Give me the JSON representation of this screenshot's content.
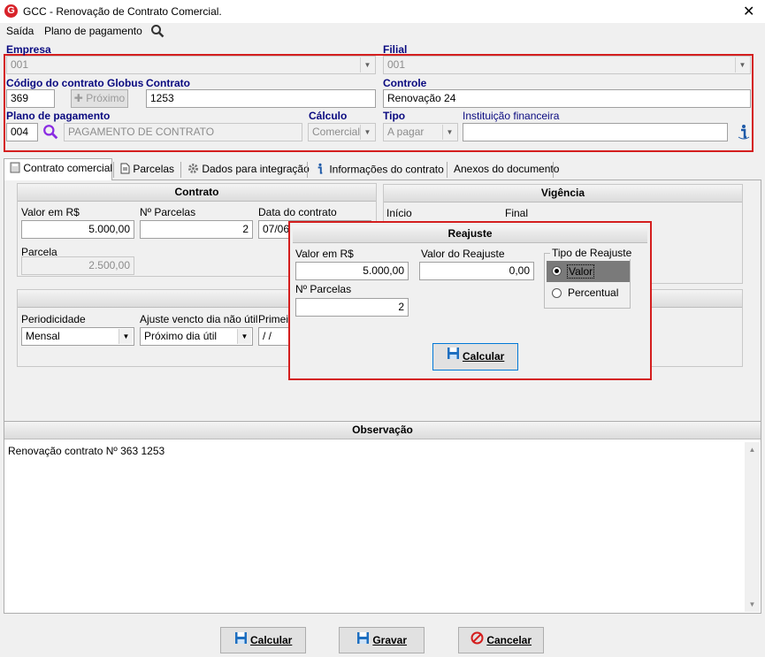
{
  "window": {
    "title": "GCC - Renovação de Contrato Comercial.",
    "logo_letter": "G"
  },
  "menu": {
    "exit_label": "Saída",
    "payment_plan_label": "Plano de pagamento"
  },
  "header": {
    "empresa_label": "Empresa",
    "empresa_value": "001",
    "filial_label": "Filial",
    "filial_value": "001",
    "codigo_label": "Código do contrato Globus",
    "codigo_value": "369",
    "proximo_label": "Próximo",
    "contrato_label": "Contrato",
    "contrato_value": "1253",
    "controle_label": "Controle",
    "controle_value": "Renovação 24",
    "plano_label": "Plano de pagamento",
    "plano_code": "004",
    "plano_desc": "PAGAMENTO DE CONTRATO",
    "calculo_label": "Cálculo",
    "calculo_value": "Comercial",
    "tipo_label": "Tipo",
    "tipo_value": "A pagar",
    "instituicao_label": "Instituição financeira",
    "instituicao_value": ""
  },
  "tabs": [
    {
      "label": "Contrato comercial"
    },
    {
      "label": "Parcelas"
    },
    {
      "label": "Dados para integração"
    },
    {
      "label": "Informações do contrato"
    },
    {
      "label": "Anexos do documento"
    }
  ],
  "contrato": {
    "title": "Contrato",
    "valor_label": "Valor em R$",
    "valor_value": "5.000,00",
    "parcelas_label": "Nº Parcelas",
    "parcelas_value": "2",
    "data_label": "Data do contrato",
    "data_value": "07/06",
    "parcela_label": "Parcela",
    "parcela_value": "2.500,00"
  },
  "vigencia": {
    "title": "Vigência",
    "inicio_label": "Início",
    "final_label": "Final"
  },
  "periodo": {
    "periodicidade_label": "Periodicidade",
    "periodicidade_value": "Mensal",
    "ajuste_label": "Ajuste vencto dia não útil",
    "ajuste_value": "Próximo dia útil",
    "primeiro_label": "Primeiro",
    "primeiro_value": "/ /"
  },
  "reajuste": {
    "title": "Reajuste",
    "valor_label": "Valor em R$",
    "valor_value": "5.000,00",
    "valor_reajuste_label": "Valor do Reajuste",
    "valor_reajuste_value": "0,00",
    "parcelas_label": "Nº Parcelas",
    "parcelas_value": "2",
    "tipo_label": "Tipo de Reajuste",
    "opt_valor": "Valor",
    "opt_percentual": "Percentual",
    "selected": "Valor",
    "calcular_label": "Calcular"
  },
  "observacao": {
    "title": "Observação",
    "text": "Renovação contrato Nº 363 1253"
  },
  "footer": {
    "calcular_label": "Calcular",
    "gravar_label": "Gravar",
    "cancelar_label": "Cancelar"
  },
  "colors": {
    "highlight_red": "#d41e1e",
    "label_navy": "#0a0a80",
    "search_purple": "#8a2be2",
    "selected_gray": "#7a7a7a"
  }
}
